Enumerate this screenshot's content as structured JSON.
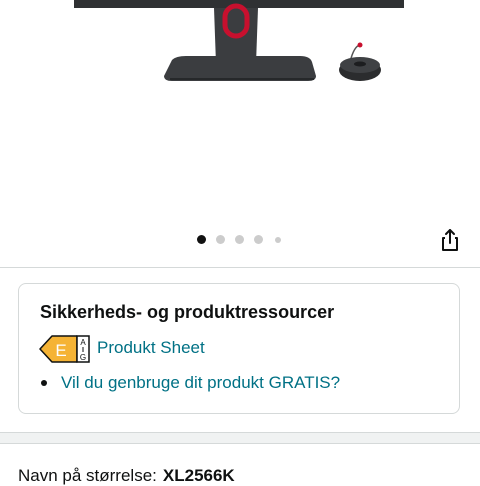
{
  "product": {
    "image_alt": "BenQ ZOWIE monitor"
  },
  "carousel": {
    "total_dots": 5,
    "active_index": 0
  },
  "share": {
    "icon": "share-icon"
  },
  "resources": {
    "title": "Sikkerheds- og produktressourcer",
    "energy_label": {
      "letter": "E",
      "scale_top": "A",
      "scale_bottom": "G",
      "color": "#f5b335"
    },
    "product_sheet_link": "Produkt Sheet",
    "recycle_link": "Vil du genbruge dit produkt GRATIS?"
  },
  "size": {
    "label": "Navn på størrelse:",
    "value": "XL2566K"
  },
  "colors": {
    "link": "#007185",
    "text": "#0f1111",
    "border": "#d5d9d9",
    "accent_red": "#c8102e"
  }
}
